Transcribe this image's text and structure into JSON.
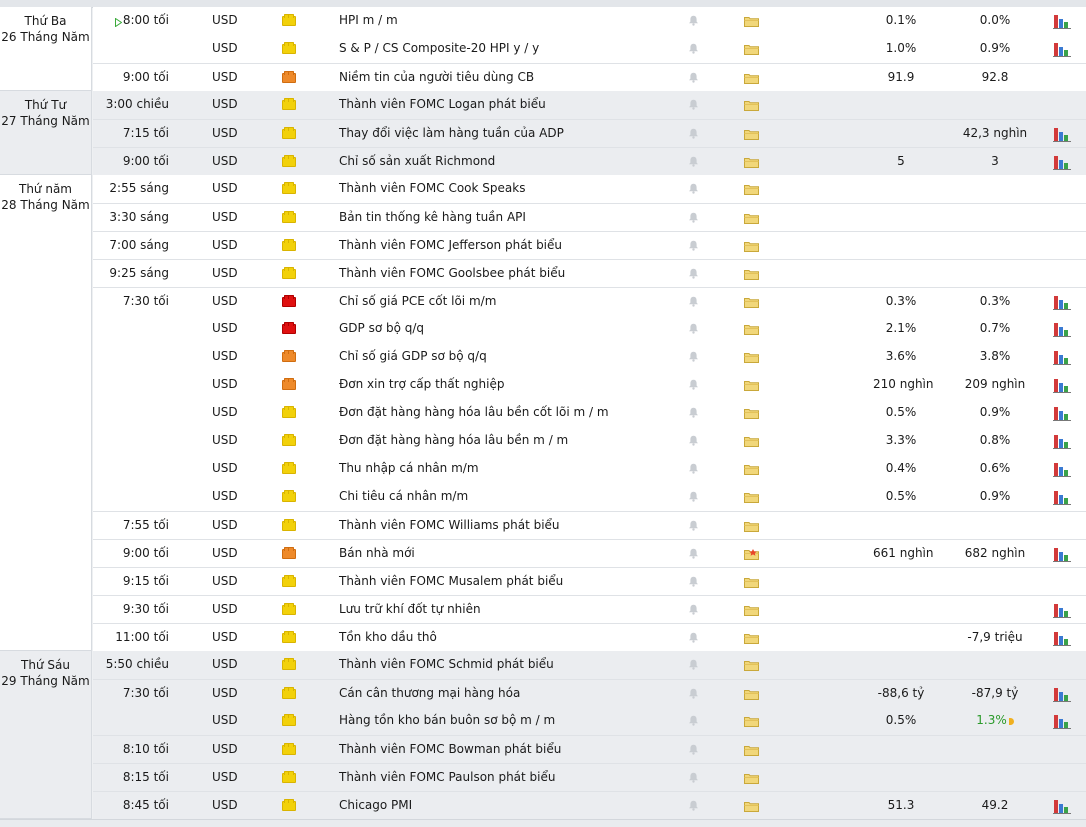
{
  "days": [
    {
      "weekday": "Thứ Ba",
      "date": "26 Tháng Năm"
    },
    {
      "weekday": "Thứ Tư",
      "date": "27 Tháng Năm"
    },
    {
      "weekday": "Thứ năm",
      "date": "28 Tháng Năm"
    },
    {
      "weekday": "Thứ Sáu",
      "date": "29 Tháng Năm"
    }
  ],
  "rows": [
    {
      "time": "8:00 tối",
      "currency": "USD",
      "event": "HPI m / m",
      "actual": "0.1%",
      "forecast": "0.0%",
      "chart": true,
      "playing": true
    },
    {
      "time": "",
      "currency": "USD",
      "event": "S & P / CS Composite-20 HPI y / y",
      "actual": "1.0%",
      "forecast": "0.9%",
      "chart": true
    },
    {
      "time": "9:00 tối",
      "currency": "USD",
      "event": "Niềm tin của người tiêu dùng CB",
      "actual": "91.9",
      "forecast": "92.8",
      "chart": false
    },
    {
      "time": "3:00 chiều",
      "currency": "USD",
      "event": "Thành viên FOMC Logan phát biểu",
      "actual": "",
      "forecast": "",
      "chart": false
    },
    {
      "time": "7:15 tối",
      "currency": "USD",
      "event": "Thay đổi việc làm hàng tuần của ADP",
      "actual": "",
      "forecast": "42,3 nghìn",
      "chart": true
    },
    {
      "time": "9:00 tối",
      "currency": "USD",
      "event": "Chỉ số sản xuất Richmond",
      "actual": "5",
      "forecast": "3",
      "chart": true
    },
    {
      "time": "2:55 sáng",
      "currency": "USD",
      "event": "Thành viên FOMC Cook Speaks",
      "actual": "",
      "forecast": "",
      "chart": false
    },
    {
      "time": "3:30 sáng",
      "currency": "USD",
      "event": "Bản tin thống kê hàng tuần API",
      "actual": "",
      "forecast": "",
      "chart": false
    },
    {
      "time": "7:00 sáng",
      "currency": "USD",
      "event": "Thành viên FOMC Jefferson phát biểu",
      "actual": "",
      "forecast": "",
      "chart": false
    },
    {
      "time": "9:25 sáng",
      "currency": "USD",
      "event": "Thành viên FOMC Goolsbee phát biểu",
      "actual": "",
      "forecast": "",
      "chart": false
    },
    {
      "time": "7:30 tối",
      "currency": "USD",
      "event": "Chỉ số giá PCE cốt lõi m/m",
      "actual": "0.3%",
      "forecast": "0.3%",
      "chart": true
    },
    {
      "time": "",
      "currency": "USD",
      "event": "GDP sơ bộ q/q",
      "actual": "2.1%",
      "forecast": "0.7%",
      "chart": true
    },
    {
      "time": "",
      "currency": "USD",
      "event": "Chỉ số giá GDP sơ bộ q/q",
      "actual": "3.6%",
      "forecast": "3.8%",
      "chart": true
    },
    {
      "time": "",
      "currency": "USD",
      "event": "Đơn xin trợ cấp thất nghiệp",
      "actual": "210 nghìn",
      "forecast": "209 nghìn",
      "chart": true
    },
    {
      "time": "",
      "currency": "USD",
      "event": "Đơn đặt hàng hàng hóa lâu bền cốt lõi m / m",
      "actual": "0.5%",
      "forecast": "0.9%",
      "chart": true
    },
    {
      "time": "",
      "currency": "USD",
      "event": "Đơn đặt hàng hàng hóa lâu bền m / m",
      "actual": "3.3%",
      "forecast": "0.8%",
      "chart": true
    },
    {
      "time": "",
      "currency": "USD",
      "event": "Thu nhập cá nhân m/m",
      "actual": "0.4%",
      "forecast": "0.6%",
      "chart": true
    },
    {
      "time": "",
      "currency": "USD",
      "event": "Chi tiêu cá nhân m/m",
      "actual": "0.5%",
      "forecast": "0.9%",
      "chart": true
    },
    {
      "time": "7:55 tối",
      "currency": "USD",
      "event": "Thành viên FOMC Williams phát biểu",
      "actual": "",
      "forecast": "",
      "chart": false
    },
    {
      "time": "9:00 tối",
      "currency": "USD",
      "event": "Bán nhà mới",
      "actual": "661 nghìn",
      "forecast": "682 nghìn",
      "chart": true,
      "folderStar": true
    },
    {
      "time": "9:15 tối",
      "currency": "USD",
      "event": "Thành viên FOMC Musalem phát biểu",
      "actual": "",
      "forecast": "",
      "chart": false
    },
    {
      "time": "9:30 tối",
      "currency": "USD",
      "event": "Lưu trữ khí đốt tự nhiên",
      "actual": "",
      "forecast": "",
      "chart": true
    },
    {
      "time": "11:00 tối",
      "currency": "USD",
      "event": "Tồn kho dầu thô",
      "actual": "",
      "forecast": "-7,9 triệu",
      "chart": true
    },
    {
      "time": "5:50 chiều",
      "currency": "USD",
      "event": "Thành viên FOMC Schmid phát biểu",
      "actual": "",
      "forecast": "",
      "chart": false
    },
    {
      "time": "7:30 tối",
      "currency": "USD",
      "event": "Cán cân thương mại hàng hóa",
      "actual": "-88,6 tỷ",
      "forecast": "-87,9 tỷ",
      "chart": true
    },
    {
      "time": "",
      "currency": "USD",
      "event": "Hàng tồn kho bán buôn sơ bộ m / m",
      "actual": "0.5%",
      "forecast": "1.3%",
      "chart": true,
      "forecastUp": true
    },
    {
      "time": "8:10 tối",
      "currency": "USD",
      "event": "Thành viên FOMC Bowman phát biểu",
      "actual": "",
      "forecast": "",
      "chart": false
    },
    {
      "time": "8:15 tối",
      "currency": "USD",
      "event": "Thành viên FOMC Paulson phát biểu",
      "actual": "",
      "forecast": "",
      "chart": false
    },
    {
      "time": "8:45 tối",
      "currency": "USD",
      "event": "Chicago PMI",
      "actual": "51.3",
      "forecast": "49.2",
      "chart": true
    }
  ],
  "impact": [
    "low",
    "low",
    "med",
    "low",
    "low",
    "low",
    "low",
    "low",
    "low",
    "low",
    "high",
    "high",
    "med",
    "med",
    "low",
    "low",
    "low",
    "low",
    "low",
    "med",
    "low",
    "low",
    "low",
    "low",
    "low",
    "low",
    "low",
    "low",
    "low"
  ],
  "colors": {
    "low": "#f2d10a",
    "medium": "#ee8a2a",
    "high": "#df1010",
    "forecast_up": "#2a9a2a",
    "shade": "#ebedf0"
  },
  "icons": {
    "impact": "folder-impact-icon",
    "alert": "bell-icon",
    "details": "folder-icon",
    "chart": "bar-chart-icon"
  }
}
